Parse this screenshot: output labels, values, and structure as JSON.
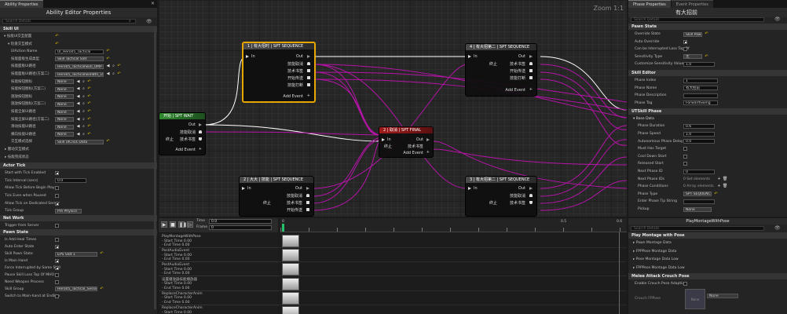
{
  "left": {
    "tab": "Ability Properties",
    "title": "Ability Editor Properties",
    "search": "Search Details",
    "skill_ui_section": "Skill UI",
    "rows": [
      {
        "label": "技能UI交互配置",
        "indent": 1
      },
      {
        "label": "轮盘交互模式",
        "indent": 2
      },
      {
        "label": "UIAction Name",
        "value": "UI_Hero05_Tactical",
        "type": "field"
      },
      {
        "label": "技能面板生成类型",
        "value": "Skill Tactical Slot",
        "type": "combo"
      },
      {
        "label": "技能面板UI路径",
        "value": "Hero05_TacticalSkill_UMP",
        "type": "combo"
      },
      {
        "label": "技能面板UI路径(方案二)",
        "value": "Hero05_TacticalSkillBtn_UMP_Planar",
        "type": "combo"
      },
      {
        "label": "技能按钮图标",
        "value": "None",
        "type": "combo"
      },
      {
        "label": "技能按钮图标(方案二)",
        "value": "None",
        "type": "combo"
      },
      {
        "label": "施放按钮图标",
        "value": "None",
        "type": "combo"
      },
      {
        "label": "施放按钮图标(方案二)",
        "value": "None",
        "type": "combo"
      },
      {
        "label": "技能全屏UI路径",
        "value": "None",
        "type": "combo"
      },
      {
        "label": "技能全屏UI路径(方案二)",
        "value": "None",
        "type": "combo"
      },
      {
        "label": "滑动技能UI路径",
        "value": "None",
        "type": "combo"
      },
      {
        "label": "横向技能UI路径",
        "value": "None",
        "type": "combo"
      },
      {
        "label": "交互模式选择",
        "value": "Skill UIClick Data",
        "type": "combo"
      }
    ],
    "extra_rows": [
      "震动交互模式",
      "技能完成状态"
    ],
    "actor_tick_section": "Actor Tick",
    "actor_tick": [
      {
        "label": "Start with Tick Enabled",
        "check": true
      },
      {
        "label": "Tick Interval (secs)",
        "value": "0.0",
        "type": "field"
      },
      {
        "label": "Allow Tick Before Begin Play",
        "check": false
      },
      {
        "label": "Tick Even when Paused",
        "check": false
      },
      {
        "label": "Allow Tick on Dedicated Server",
        "check": true
      },
      {
        "label": "Tick Group",
        "value": "Pre Physics",
        "type": "combo"
      }
    ],
    "network_section": "Net Work",
    "network": [
      {
        "label": "Trigger from Server",
        "check": false
      }
    ],
    "pawn_section": "Pawn State",
    "pawn": [
      {
        "label": "Is Add Heal Times",
        "check": false
      },
      {
        "label": "Auto Enter State",
        "check": true
      },
      {
        "label": "Skill Pawn State",
        "value": "EPS Slot 1",
        "type": "combo"
      },
      {
        "label": "Is Main Hand",
        "check": true
      },
      {
        "label": "Force Interrupted by Same Skill",
        "check": true
      },
      {
        "label": "Pause Skill Loss Top Of MHO",
        "check": false
      },
      {
        "label": "Need Weapon Process",
        "check": false
      },
      {
        "label": "Skill Group",
        "value": "Hero05_Tactical_Session",
        "type": "combo"
      },
      {
        "label": "Switch to Main-hand at Endline",
        "check": false
      }
    ]
  },
  "graph": {
    "zoom": "Zoom 1:1",
    "nodes": {
      "seq1": {
        "title": "1 | 有大招时 | SPT SEQUENCE",
        "in": "In",
        "outs": [
          "Out",
          "技能取消",
          "技术书签",
          "开始传送",
          "技能打断"
        ],
        "add": "Add Event"
      },
      "seq4": {
        "title": "4 | 有大招第二 | SPT SEQUENCE",
        "in": "In",
        "outs": [
          "Out",
          "技术书签",
          "开始传送",
          "技能打断"
        ],
        "term": "终止",
        "add": "Add Event"
      },
      "wait": {
        "title": "开始 | SPT WAIT",
        "outs": [
          "Out",
          "技能取消",
          "技术书签"
        ],
        "term": "终止",
        "add": "Add Event"
      },
      "final": {
        "title": "2 | 取消 | SPT FINAL",
        "in": "In",
        "outs": [
          "Out",
          "技术书签"
        ],
        "term": "终止",
        "add": "Add Event"
      },
      "seq2": {
        "title": "2 | 大大 | 技能 | SPT SEQUENCE",
        "in": "In",
        "outs": [
          "Out",
          "技能取消",
          "技术书签",
          "开始传送"
        ],
        "term": "终止"
      },
      "seq3": {
        "title": "3 | 有大招第二 | SPT SEQUENCE",
        "in": "In",
        "outs": [
          "Out",
          "技能取消",
          "技术书签"
        ],
        "term": "终止"
      }
    }
  },
  "timeline": {
    "time_label": "Time",
    "frame_label": "Frame",
    "time_value": "0.0",
    "frame_value": "0",
    "ticks": [
      "0",
      "0.5",
      "0.6"
    ],
    "tracks": [
      {
        "name": "PlayMontageWithPose",
        "start": "Start Time 0.00",
        "end": "End Time 0.00"
      },
      {
        "name": "PostAudioEvent",
        "start": "Start Time 0.00",
        "end": "End Time 0.00"
      },
      {
        "name": "PostAudioEvent",
        "start": "Start Time 0.00",
        "end": "End Time 0.00"
      },
      {
        "name": "设置播放器技能播放器",
        "start": "Start Time 0.00",
        "end": "End Time 0.00"
      },
      {
        "name": "ReplaceCharacterAnim",
        "start": "Start Time 0.00",
        "end": "End Time 0.00"
      },
      {
        "name": "ReplaceCharacterAnim",
        "start": "Start Time 0.00",
        "end": ""
      }
    ]
  },
  "right": {
    "tab1": "Phase Properties",
    "tab2": "Event Properties",
    "title": "有大招前",
    "search": "Search Details",
    "pawn_state_section": "Pawn State",
    "pawn_state": [
      {
        "label": "Override State",
        "value": "Skill Pawn",
        "type": "combo"
      },
      {
        "label": "Auto Override",
        "check": true
      },
      {
        "label": "Can be Interrupted Loss Top Of",
        "check": false
      },
      {
        "label": "Sensitivity Type",
        "value": "无",
        "type": "combo"
      },
      {
        "label": "Customize Sensitivity Value",
        "value": "1.0",
        "type": "field"
      }
    ],
    "skill_editor_section": "Skill Editor",
    "skill_editor": [
      {
        "label": "Phase Index",
        "value": "1",
        "type": "field"
      },
      {
        "label": "Phase Name",
        "value": "有大招前",
        "type": "field"
      },
      {
        "label": "Phase Description",
        "value": "",
        "type": "field"
      },
      {
        "label": "Phase Tag",
        "value": "ForwardSwing",
        "type": "field"
      }
    ],
    "utskill_section": "UTSkill Phase",
    "base_data": "Base Data",
    "utskill": [
      {
        "label": "Phase Duration",
        "value": "0.6",
        "type": "field"
      },
      {
        "label": "Phase Speed",
        "value": "1.0",
        "type": "field"
      },
      {
        "label": "Autonomous Phase Delay",
        "value": "0.0",
        "type": "field"
      },
      {
        "label": "Must Has Target",
        "check": false
      },
      {
        "label": "Cool Down Start",
        "check": false
      },
      {
        "label": "Released Start",
        "check": false
      },
      {
        "label": "Next Phase ID",
        "value": "0",
        "type": "field"
      },
      {
        "label": "Next Phase IDs",
        "value": "0 Set elements",
        "type": "text"
      },
      {
        "label": "Phase Conditions",
        "value": "0 Array elements",
        "type": "text"
      },
      {
        "label": "Phase Type",
        "value": "SPT SEQUENCE",
        "type": "combo"
      },
      {
        "label": "Enter Phase Tip String",
        "value": "",
        "type": "field"
      },
      {
        "label": "Pickup",
        "value": "None",
        "type": "combo"
      }
    ]
  },
  "bottom_right": {
    "title": "PlayMontageWithPose",
    "search": "Search Details",
    "section1": "Play Montage with Pose",
    "rows1": [
      "Pawn Montage Data",
      "FPPPose Montage Data",
      "Pose Montage Data Low",
      "FPPPose Montage Data Low"
    ],
    "section2": "Melee Attack Crouch Pose",
    "rows2": [
      {
        "label": "Enable Crouch Pose Adaption",
        "check": false
      }
    ],
    "crouch_label": "Crouch FPPose",
    "crouch_value": "None",
    "crouch_thumb": "None"
  }
}
